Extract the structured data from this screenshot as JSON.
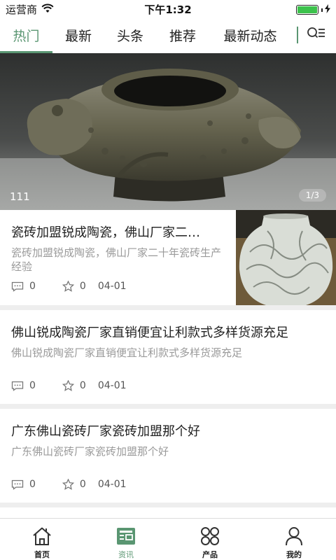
{
  "status_bar": {
    "carrier": "运营商",
    "time": "下午1:32"
  },
  "tabs": [
    {
      "label": "热门",
      "active": true
    },
    {
      "label": "最新",
      "active": false
    },
    {
      "label": "头条",
      "active": false
    },
    {
      "label": "推荐",
      "active": false
    },
    {
      "label": "最新动态",
      "active": false
    }
  ],
  "banner": {
    "caption": "111",
    "page_indicator": "1/3"
  },
  "news": [
    {
      "title": "瓷砖加盟锐成陶瓷，佛山厂家二…",
      "summary": "瓷砖加盟锐成陶瓷，佛山厂家二十年瓷砖生产经验",
      "comments": "0",
      "favorites": "0",
      "date": "04-01",
      "has_image": true
    },
    {
      "title": "佛山锐成陶瓷厂家直销便宜让利款式多样货源充足",
      "summary": "佛山锐成陶瓷厂家直销便宜让利款式多样货源充足",
      "comments": "0",
      "favorites": "0",
      "date": "04-01",
      "has_image": false
    },
    {
      "title": "广东佛山瓷砖厂家瓷砖加盟那个好",
      "summary": "广东佛山瓷砖厂家瓷砖加盟那个好",
      "comments": "0",
      "favorites": "0",
      "date": "04-01",
      "has_image": false
    }
  ],
  "bottom_nav": [
    {
      "label": "首页",
      "icon": "home-icon",
      "active": false
    },
    {
      "label": "资讯",
      "icon": "news-icon",
      "active": true
    },
    {
      "label": "产品",
      "icon": "products-icon",
      "active": false
    },
    {
      "label": "我的",
      "icon": "user-icon",
      "active": false
    }
  ],
  "colors": {
    "accent": "#5a9672",
    "divider": "#eeeeee",
    "summary_text": "#9a9a9a"
  }
}
